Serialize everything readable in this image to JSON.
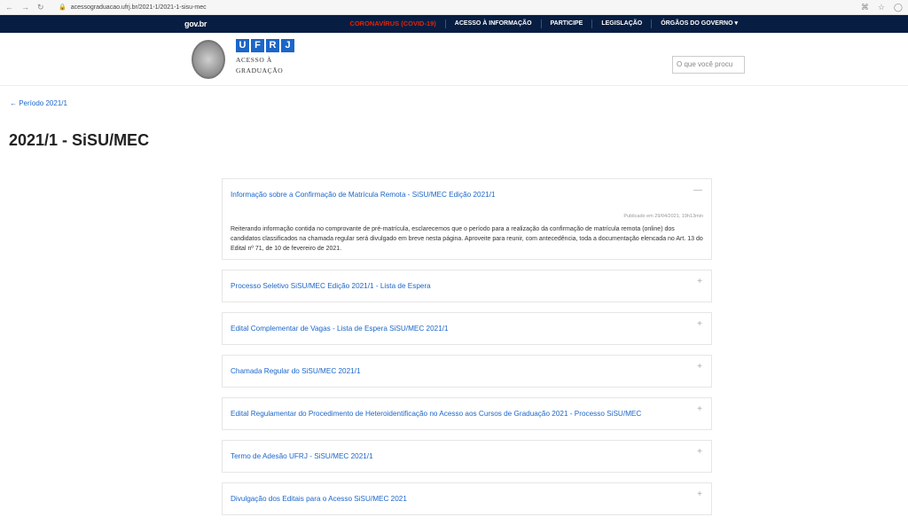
{
  "browser": {
    "url": "acessograduacao.ufrj.br/2021-1/2021-1-sisu-mec"
  },
  "govbar": {
    "logo": "gov.br",
    "links": [
      "CORONAVÍRUS (COVID-19)",
      "ACESSO À INFORMAÇÃO",
      "PARTICIPE",
      "LEGISLAÇÃO",
      "ÓRGÃOS DO GOVERNO ▾"
    ]
  },
  "header": {
    "ufrj_letters": [
      "U",
      "F",
      "R",
      "J"
    ],
    "subtitle_line1": "ACESSO À",
    "subtitle_line2": "GRADUAÇÃO",
    "search_placeholder": "O que você procu"
  },
  "breadcrumb": "← Período 2021/1",
  "page_title": "2021/1 - SiSU/MEC",
  "items": [
    {
      "title": "Informação sobre a Confirmação de Matrícula Remota - SiSU/MEC Edição 2021/1",
      "toggle": "—",
      "published": "Publicado em 29/04/2021, 19h13min",
      "body": "Reiterando informação contida no comprovante de pré-matrícula, esclarecemos que o período para a realização da confirmação de matrícula remota (online) dos candidatos classificados na chamada regular será divulgado em breve nesta página. Aproveite para reunir, com antecedência, toda a documentação elencada no Art. 13 do Edital nº 71, de 10 de fevereiro de 2021."
    },
    {
      "title": "Processo Seletivo SiSU/MEC Edição 2021/1 - Lista de Espera",
      "toggle": "+"
    },
    {
      "title": "Edital Complementar de Vagas - Lista de Espera SiSU/MEC 2021/1",
      "toggle": "+"
    },
    {
      "title": "Chamada Regular do SiSU/MEC 2021/1",
      "toggle": "+"
    },
    {
      "title": "Edital Regulamentar do Procedimento de Heteroidentificação no Acesso aos Cursos de Graduação 2021 - Processo SiSU/MEC",
      "toggle": "+"
    },
    {
      "title": "Termo de Adesão UFRJ - SiSU/MEC 2021/1",
      "toggle": "+"
    },
    {
      "title": "Divulgação dos Editais para o Acesso SiSU/MEC 2021",
      "toggle": "+"
    }
  ]
}
